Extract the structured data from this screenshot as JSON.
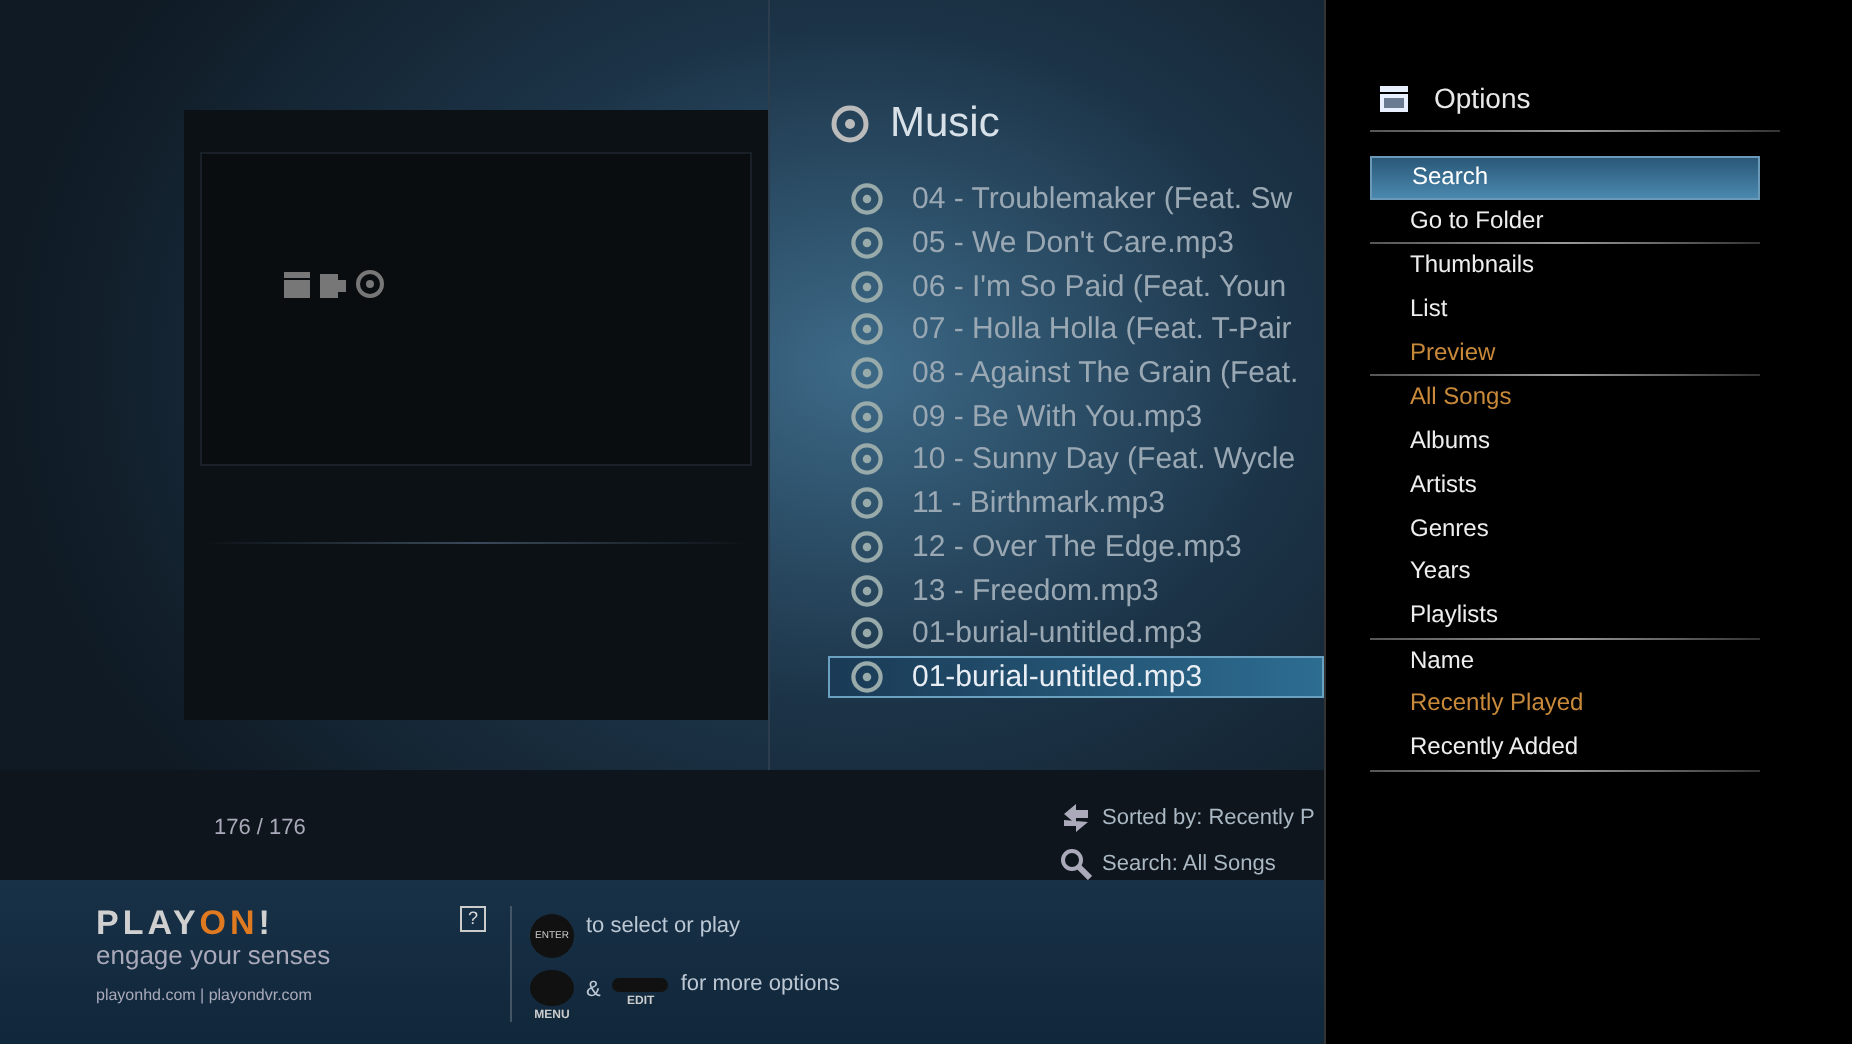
{
  "preview": {
    "count": "176 / 176"
  },
  "music": {
    "title": "Music",
    "songs": [
      {
        "name": "04 - Troublemaker (Feat. Sw",
        "selected": false
      },
      {
        "name": "05 - We Don't Care.mp3",
        "selected": false
      },
      {
        "name": "06 - I'm So Paid (Feat. Youn",
        "selected": false
      },
      {
        "name": "07 - Holla Holla (Feat. T-Pair",
        "selected": false
      },
      {
        "name": "08 - Against The Grain (Feat.",
        "selected": false
      },
      {
        "name": "09 - Be With You.mp3",
        "selected": false
      },
      {
        "name": "10 - Sunny Day (Feat. Wycle",
        "selected": false
      },
      {
        "name": "11 - Birthmark.mp3",
        "selected": false
      },
      {
        "name": "12 - Over The Edge.mp3",
        "selected": false
      },
      {
        "name": "13 - Freedom.mp3",
        "selected": false
      },
      {
        "name": "01-burial-untitled.mp3",
        "selected": false
      },
      {
        "name": "01-burial-untitled.mp3",
        "selected": true
      }
    ],
    "sorted_by": "Sorted by: Recently P",
    "search": "Search: All Songs"
  },
  "options": {
    "title": "Options",
    "groups": [
      [
        {
          "label": "Search",
          "selected": true,
          "active": false
        },
        {
          "label": "Go to Folder",
          "selected": false,
          "active": false
        }
      ],
      [
        {
          "label": "Thumbnails",
          "selected": false,
          "active": false
        },
        {
          "label": "List",
          "selected": false,
          "active": false
        },
        {
          "label": "Preview",
          "selected": false,
          "active": true
        }
      ],
      [
        {
          "label": "All Songs",
          "selected": false,
          "active": true
        },
        {
          "label": "Albums",
          "selected": false,
          "active": false
        },
        {
          "label": "Artists",
          "selected": false,
          "active": false
        },
        {
          "label": "Genres",
          "selected": false,
          "active": false
        },
        {
          "label": "Years",
          "selected": false,
          "active": false
        },
        {
          "label": "Playlists",
          "selected": false,
          "active": false
        }
      ],
      [
        {
          "label": "Name",
          "selected": false,
          "active": false
        },
        {
          "label": "Recently Played",
          "selected": false,
          "active": true
        },
        {
          "label": "Recently Added",
          "selected": false,
          "active": false
        }
      ]
    ]
  },
  "footer": {
    "logo": [
      {
        "text": "PLAY",
        "accent": false
      },
      {
        "text": "ON",
        "accent": true
      },
      {
        "text": "!",
        "accent": false
      }
    ],
    "tagline": "engage your senses",
    "links": "playonhd.com | playondvr.com",
    "help_icon": "?",
    "enter_key": "ENTER",
    "select_hint": "to select or play",
    "and": "&",
    "options_hint": "for more options",
    "menu_label": "MENU",
    "edit_label": "EDIT"
  }
}
